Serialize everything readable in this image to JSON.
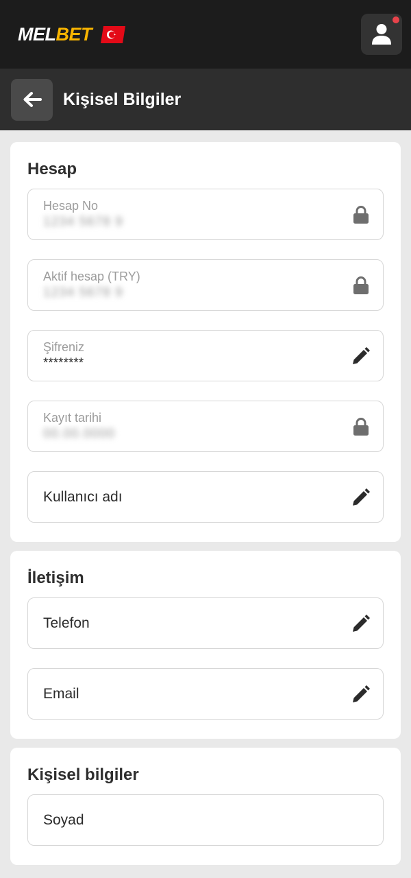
{
  "brand": {
    "name_part1": "MEL",
    "name_part2": "BET"
  },
  "header": {
    "title": "Kişisel Bilgiler"
  },
  "sections": {
    "account": {
      "title": "Hesap",
      "fields": {
        "account_no": {
          "label": "Hesap No",
          "value": "1234 5678 9"
        },
        "active_account": {
          "label": "Aktif hesap (TRY)",
          "value": "1234 5678 9"
        },
        "password": {
          "label": "Şifreniz",
          "value": "********"
        },
        "registration_date": {
          "label": "Kayıt tarihi",
          "value": "00.00.0000"
        },
        "username": {
          "label": "Kullanıcı adı"
        }
      }
    },
    "contact": {
      "title": "İletişim",
      "fields": {
        "phone": {
          "label": "Telefon"
        },
        "email": {
          "label": "Email"
        }
      }
    },
    "personal": {
      "title": "Kişisel bilgiler",
      "fields": {
        "surname": {
          "label": "Soyad"
        }
      }
    }
  },
  "icons": {
    "locked": "lock-icon",
    "editable": "pencil-icon",
    "user": "user-icon",
    "back": "arrow-left-icon"
  },
  "colors": {
    "header_bg": "#1c1c1c",
    "subheader_bg": "#2e2e2e",
    "brand_accent": "#f8b400",
    "notification_dot": "#e8434b",
    "flag_red": "#e30a17"
  }
}
